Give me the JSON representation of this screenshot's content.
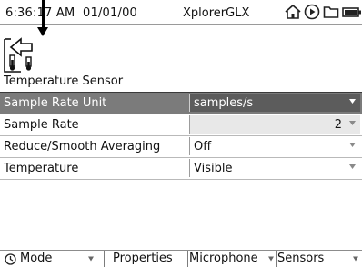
{
  "status_bar": {
    "time": "6:36:17 AM",
    "date": "01/01/00",
    "app_name": "XplorerGLX",
    "icons": [
      "home-icon",
      "play-icon",
      "folder-icon",
      "battery-icon"
    ]
  },
  "sensor": {
    "title": "Temperature Sensor",
    "icon": "temperature-sensor-icon"
  },
  "properties": [
    {
      "label": "Sample Rate Unit",
      "value": "samples/s"
    },
    {
      "label": "Sample Rate",
      "value": "2"
    },
    {
      "label": "Reduce/Smooth Averaging",
      "value": "Off"
    },
    {
      "label": "Temperature",
      "value": "Visible"
    }
  ],
  "function_keys": {
    "mode": "Mode",
    "properties": "Properties",
    "microphone": "Microphone",
    "sensors": "Sensors"
  },
  "colors": {
    "selected_row": "#7b7b7b",
    "selected_value": "#5c5c5c",
    "shaded_value": "#e8e8e8"
  }
}
